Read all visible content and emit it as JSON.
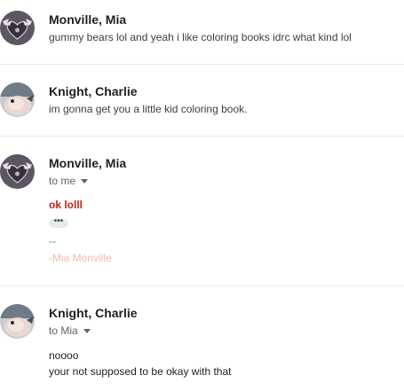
{
  "messages": [
    {
      "sender": "Monville, Mia",
      "snippet": "gummy bears lol and yeah i like coloring books idrc what kind lol",
      "avatar_icon": "bat-heart-avatar"
    },
    {
      "sender": "Knight, Charlie",
      "snippet": "im gonna get you a little kid coloring book.",
      "avatar_icon": "bird-avatar"
    },
    {
      "sender": "Monville, Mia",
      "to": "to me",
      "body_highlight": "ok lolll",
      "ellipsis": "•••",
      "sig_separator": "--",
      "signature": "-Mia Monville",
      "avatar_icon": "bat-heart-avatar"
    },
    {
      "sender": "Knight, Charlie",
      "to": "to Mia",
      "body_lines": [
        "noooo",
        "your not supposed to be okay with that"
      ],
      "avatar_icon": "bird-avatar"
    }
  ],
  "colors": {
    "highlight_red": "#c5221f",
    "signature_pink": "#f2b8b5",
    "divider": "#e8eaed"
  }
}
